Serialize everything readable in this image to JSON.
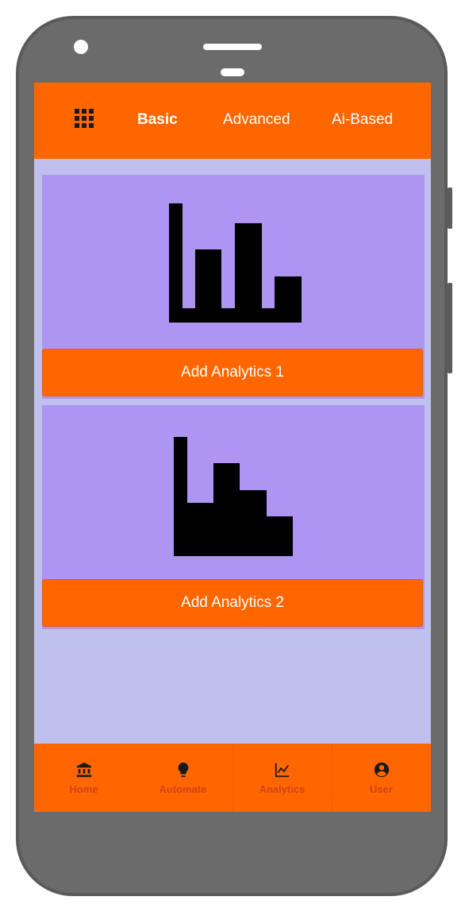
{
  "header": {
    "menu_icon": "grid-icon",
    "tabs": [
      {
        "label": "Basic",
        "active": true
      },
      {
        "label": "Advanced",
        "active": false
      },
      {
        "label": "Ai-Based",
        "active": false
      }
    ]
  },
  "cards": [
    {
      "icon": "bar-chart-icon",
      "button_label": "Add Analytics 1"
    },
    {
      "icon": "area-step-chart-icon",
      "button_label": "Add Analytics 2"
    }
  ],
  "bottom_nav": [
    {
      "label": "Home",
      "icon": "bank-icon"
    },
    {
      "label": "Automate",
      "icon": "lightbulb-icon"
    },
    {
      "label": "Analytics",
      "icon": "line-chart-icon"
    },
    {
      "label": "User",
      "icon": "account-circle-icon"
    }
  ],
  "colors": {
    "accent": "#ff6600",
    "screen_bg": "#c0c0ee",
    "card_bg": "#ad95f1",
    "nav_label": "#d0421a",
    "phone_body": "#6b6b6b"
  }
}
